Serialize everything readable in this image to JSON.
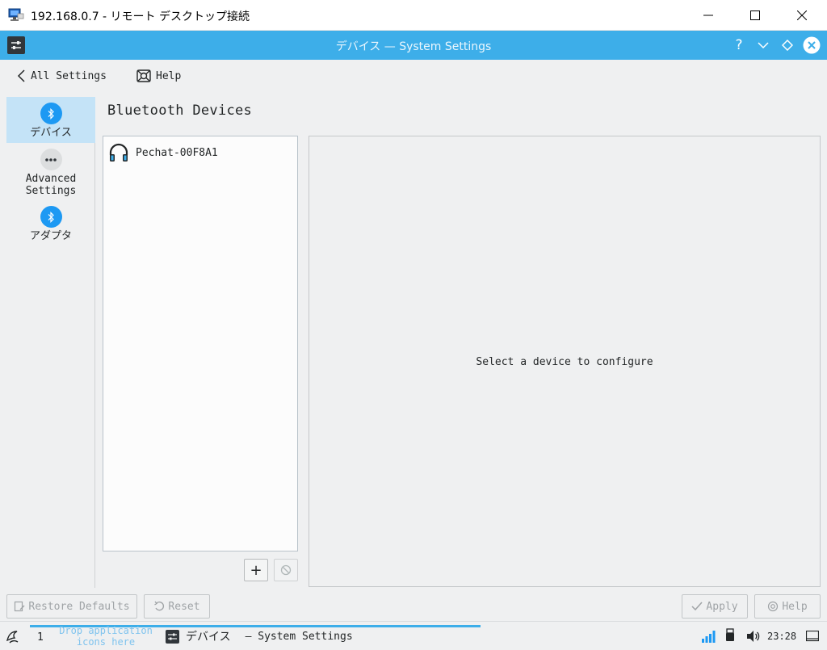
{
  "rdp": {
    "title": "192.168.0.7 - リモート デスクトップ接続"
  },
  "kde": {
    "window_title": "デバイス — System Settings",
    "help_glyph": "?"
  },
  "nav": {
    "back_label": "All Settings",
    "help_label": "Help"
  },
  "sidebar": {
    "items": [
      {
        "label": "デバイス",
        "icon": "bluetooth-icon",
        "selected": true
      },
      {
        "label": "Advanced\nSettings",
        "icon": "more-icon",
        "selected": false
      },
      {
        "label": "アダプタ",
        "icon": "bluetooth-icon",
        "selected": false
      }
    ]
  },
  "main": {
    "heading": "Bluetooth Devices",
    "devices": [
      {
        "name": "Pechat-00F8A1",
        "icon": "headphones-icon"
      }
    ],
    "add_glyph": "+",
    "detail_message": "Select a device to configure"
  },
  "footer": {
    "restore_label": "Restore Defaults",
    "reset_label": "Reset",
    "apply_label": "Apply",
    "help_label": "Help"
  },
  "taskbar": {
    "desktop_number": "1",
    "drop_hint": "Drop application icons here",
    "task_title_jp": "デバイス",
    "task_title_rest": "— System Settings",
    "clock": "23:28"
  },
  "colors": {
    "accent": "#3daee9",
    "titlebar": "#3daee9",
    "selection": "#c4e3f7",
    "bluetooth": "#1d99f3"
  }
}
